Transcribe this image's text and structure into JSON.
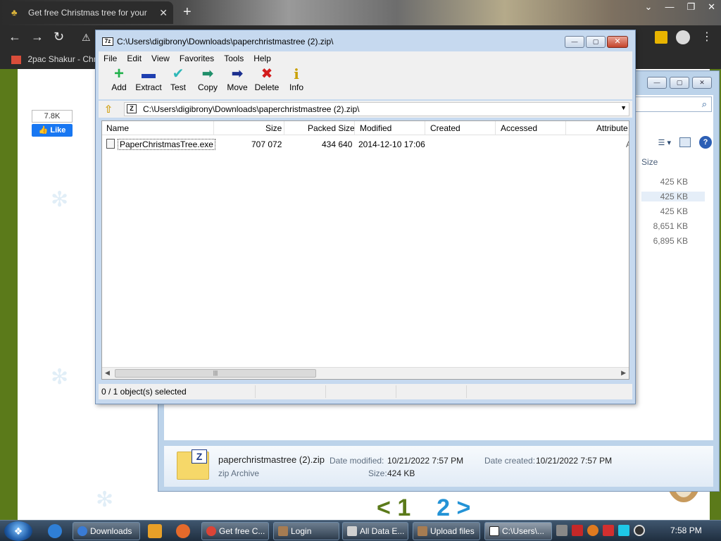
{
  "browser": {
    "tab_title": "Get free Christmas tree for your",
    "bookmark_label": "2pac Shakur - Chro"
  },
  "page": {
    "fb_like_count": "7.8K",
    "fb_like_label": "Like",
    "pager": {
      "prev": "<",
      "page1": "1",
      "page2": "2",
      "next": ">"
    }
  },
  "explorer": {
    "size_header": "Size",
    "sizes": [
      "425 KB",
      "425 KB",
      "425 KB",
      "8,651 KB",
      "6,895 KB"
    ],
    "details": {
      "name": "paperchristmastree (2).zip",
      "type": "zip Archive",
      "modified_label": "Date modified:",
      "modified_value": "10/21/2022 7:57 PM",
      "created_label": "Date created:",
      "created_value": "10/21/2022 7:57 PM",
      "size_label": "Size:",
      "size_value": "424 KB"
    }
  },
  "sevenzip": {
    "app_icon": "7z",
    "title": "C:\\Users\\digibrony\\Downloads\\paperchristmastree (2).zip\\",
    "menu": [
      "File",
      "Edit",
      "View",
      "Favorites",
      "Tools",
      "Help"
    ],
    "toolbar": [
      {
        "label": "Add",
        "icon": "plus-icon",
        "glyph": "+",
        "color": "#22b14c"
      },
      {
        "label": "Extract",
        "icon": "minus-icon",
        "glyph": "▬",
        "color": "#1f3fb0"
      },
      {
        "label": "Test",
        "icon": "check-icon",
        "glyph": "✔",
        "color": "#2fb8b8"
      },
      {
        "label": "Copy",
        "icon": "arrow-right-icon",
        "glyph": "➡",
        "color": "#1f8f6a"
      },
      {
        "label": "Move",
        "icon": "arrow-right-icon",
        "glyph": "➡",
        "color": "#1b2f8f"
      },
      {
        "label": "Delete",
        "icon": "x-icon",
        "glyph": "✖",
        "color": "#d31c1c"
      },
      {
        "label": "Info",
        "icon": "info-icon",
        "glyph": "i",
        "color": "#c9a000"
      }
    ],
    "address": "C:\\Users\\digibrony\\Downloads\\paperchristmastree (2).zip\\",
    "columns": [
      "Name",
      "Size",
      "Packed Size",
      "Modified",
      "Created",
      "Accessed",
      "Attribute"
    ],
    "rows": [
      {
        "name": "PaperChristmasTree.exe",
        "size": "707 072",
        "packed": "434 640",
        "modified": "2014-12-10 17:06",
        "created": "",
        "accessed": "",
        "attr": "A"
      }
    ],
    "status": "0 / 1 object(s) selected"
  },
  "taskbar": {
    "tasks": [
      "Downloads",
      "Get free C...",
      "Login",
      "All Data E...",
      "Upload files",
      "C:\\Users\\..."
    ],
    "clock": "7:58 PM"
  }
}
